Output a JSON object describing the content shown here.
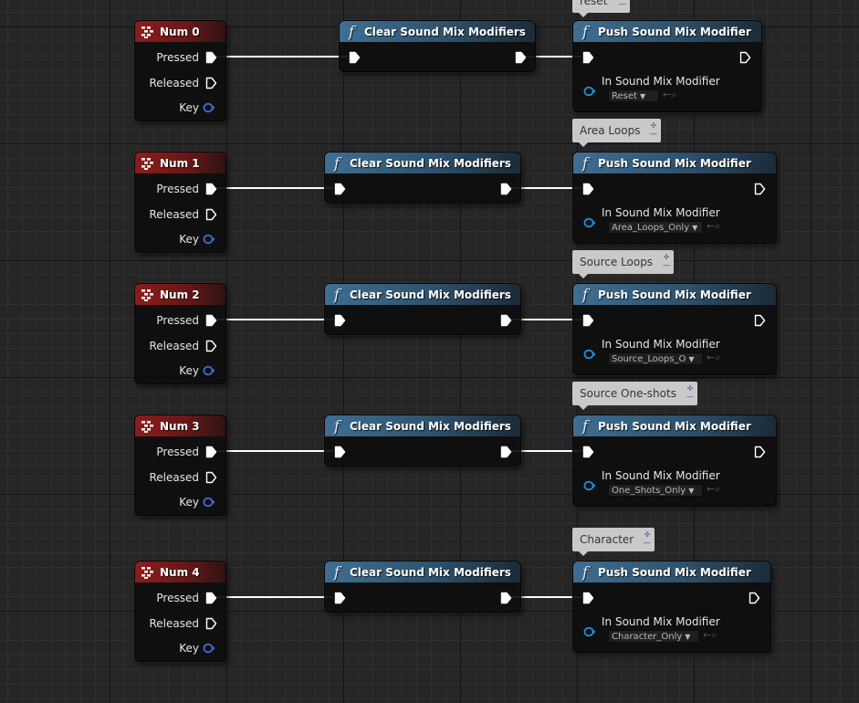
{
  "event_pins": {
    "pressed": "Pressed",
    "released": "Released",
    "key": "Key"
  },
  "clear_title": "Clear Sound Mix Modifiers",
  "push_title": "Push Sound Mix Modifier",
  "push_param": "In Sound Mix Modifier",
  "rows": [
    {
      "event": "Num 0",
      "comment": "reset",
      "modifier": "Reset"
    },
    {
      "event": "Num 1",
      "comment": "Area Loops",
      "modifier": "Area_Loops_Only"
    },
    {
      "event": "Num 2",
      "comment": "Source Loops",
      "modifier": "Source_Loops_O"
    },
    {
      "event": "Num 3",
      "comment": "Source One-shots",
      "modifier": "One_Shots_Only"
    },
    {
      "event": "Num 4",
      "comment": "Character",
      "modifier": "Character_Only"
    }
  ],
  "colors": {
    "event_header": "#8e1c1c",
    "function_header": "#3f6e92",
    "object_pin": "#1a8fd8",
    "key_pin": "#3e6cd0",
    "wire": "#ffffff"
  },
  "icons": {
    "event": "event-node-icon",
    "function": "function-icon",
    "exec": "exec-pin-icon"
  }
}
